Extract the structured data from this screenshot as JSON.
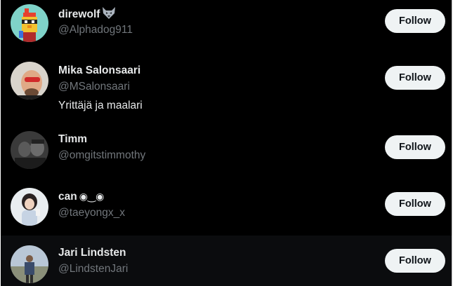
{
  "colors": {
    "background": "#000000",
    "name_text": "#e7e9ea",
    "handle_text": "#71767b",
    "button_bg": "#eff3f4",
    "button_text": "#0f1419",
    "hover_row": "#0b0c0e"
  },
  "follow_suggestions": [
    {
      "name": "direwolf",
      "name_suffix_icon": "wolf-emoji-icon",
      "handle": "@Alphadog911",
      "bio": "",
      "follow_label": "Follow"
    },
    {
      "name": "Mika Salonsaari",
      "handle": "@MSalonsaari",
      "bio": "Yrittäjä ja maalari",
      "follow_label": "Follow"
    },
    {
      "name": "Timm",
      "handle": "@omgitstimmothy",
      "bio": "",
      "follow_label": "Follow"
    },
    {
      "name": "can",
      "name_suffix_text": "◉‿◉",
      "handle": "@taeyongx_x",
      "bio": "",
      "follow_label": "Follow"
    },
    {
      "name": "Jari Lindsten",
      "handle": "@LindstenJari",
      "bio": "",
      "follow_label": "Follow"
    }
  ]
}
